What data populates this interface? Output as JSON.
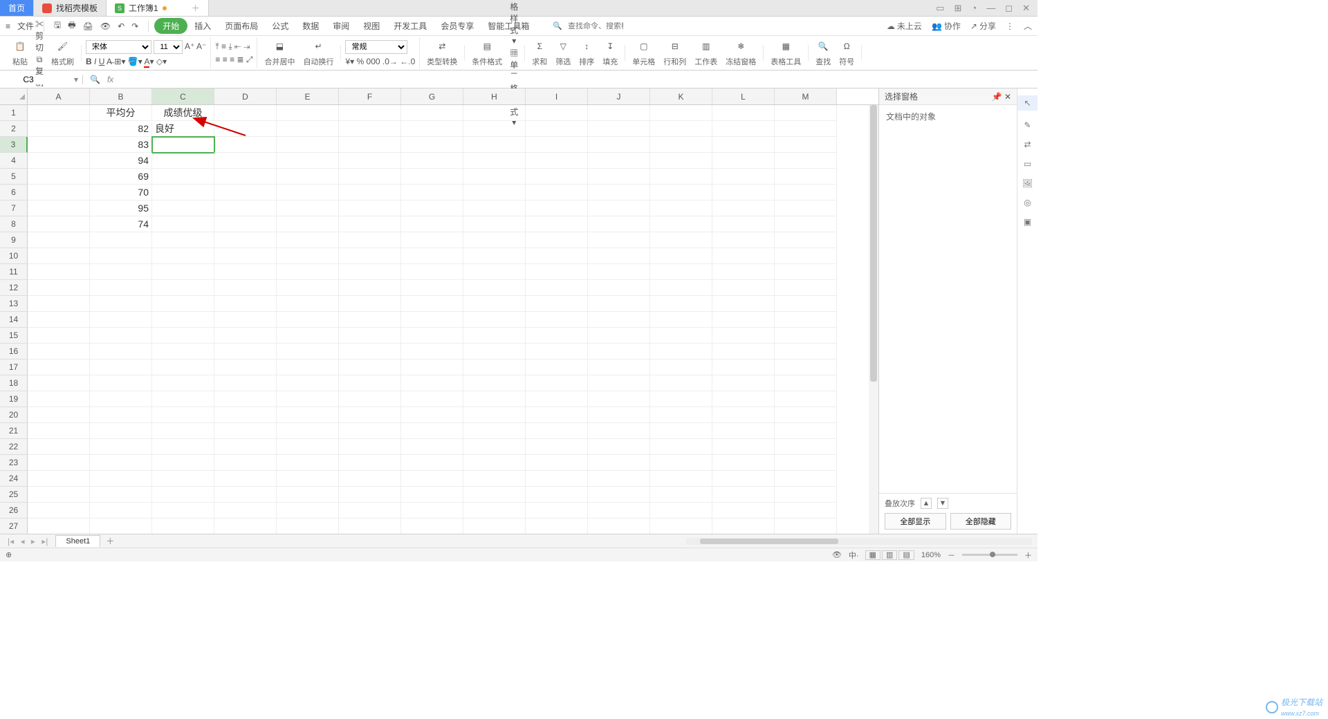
{
  "tabs": {
    "home": "首页",
    "template": "找稻壳模板",
    "workbook": "工作簿1"
  },
  "menu": {
    "file": "文件",
    "items": [
      "开始",
      "插入",
      "页面布局",
      "公式",
      "数据",
      "审阅",
      "视图",
      "开发工具",
      "会员专享",
      "智能工具箱"
    ],
    "search_placeholder": "查找命令、搜索模板",
    "cloud": "未上云",
    "coop": "协作",
    "share": "分享"
  },
  "ribbon": {
    "paste": "粘贴",
    "cut": "剪切",
    "copy": "复制",
    "format_painter": "格式刷",
    "font_name": "宋体",
    "font_size": "11",
    "number_format": "常规",
    "merge": "合并居中",
    "wrap": "自动换行",
    "type_convert": "类型转换",
    "cond_format": "条件格式",
    "table_style": "表格样式",
    "cell_style": "单元格样式",
    "sum": "求和",
    "filter": "筛选",
    "sort": "排序",
    "fill": "填充",
    "cell": "单元格",
    "rowcol": "行和列",
    "worksheet": "工作表",
    "freeze": "冻结窗格",
    "table_tools": "表格工具",
    "find": "查找",
    "symbol": "符号"
  },
  "fxbar": {
    "cell_ref": "C3",
    "fx": "fx"
  },
  "columns": [
    "A",
    "B",
    "C",
    "D",
    "E",
    "F",
    "G",
    "H",
    "I",
    "J",
    "K",
    "L",
    "M"
  ],
  "row_numbers": [
    1,
    2,
    3,
    4,
    5,
    6,
    7,
    8,
    9,
    10,
    11,
    12,
    13,
    14,
    15,
    16,
    17,
    18,
    19,
    20,
    21,
    22,
    23,
    24,
    25,
    26,
    27
  ],
  "cells": {
    "B1": "平均分",
    "C1": "成绩优级",
    "B2": "82",
    "C2": "良好",
    "B3": "83",
    "B4": "94",
    "B5": "69",
    "B6": "70",
    "B7": "95",
    "B8": "74"
  },
  "selected_cell": "C3",
  "sidepanel": {
    "title": "选择窗格",
    "doc_objects": "文档中的对象",
    "order": "叠放次序",
    "show_all": "全部显示",
    "hide_all": "全部隐藏"
  },
  "sheetbar": {
    "sheet1": "Sheet1"
  },
  "status": {
    "zoom": "160%",
    "watermark": "极光下载站",
    "watermark2": "www.xz7.com"
  }
}
